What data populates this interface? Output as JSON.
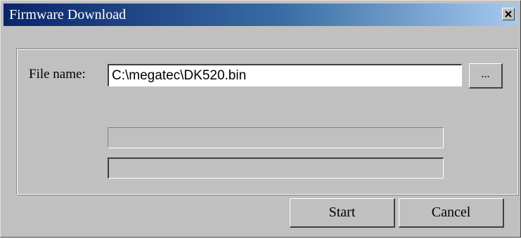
{
  "window": {
    "title": "Firmware Download",
    "close_label": "Close"
  },
  "form": {
    "file_label": "File name:",
    "file_value": "C:\\megatec\\DK520.bin",
    "browse_label": "..."
  },
  "progress": {
    "bar1_fraction": 0,
    "bar2_fraction": 0
  },
  "buttons": {
    "start_label": "Start",
    "cancel_label": "Cancel"
  },
  "colors": {
    "face": "#c0c0c0",
    "title_start": "#0a246a",
    "title_end": "#a6caf0"
  },
  "icons": {
    "close": "close-icon"
  }
}
